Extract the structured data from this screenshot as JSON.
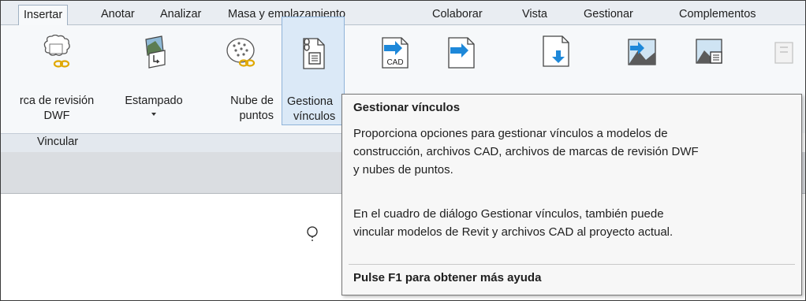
{
  "tabs": [
    {
      "label": "Insertar",
      "active": true
    },
    {
      "label": "Anotar"
    },
    {
      "label": "Analizar"
    },
    {
      "label": "Masa y emplazamiento"
    },
    {
      "label": "Colaborar"
    },
    {
      "label": "Vista"
    },
    {
      "label": "Gestionar"
    },
    {
      "label": "Complementos"
    }
  ],
  "ribbon": {
    "tools": [
      {
        "line1": "rca de revisión",
        "line2": "DWF",
        "icon": "dwf-markup-link-icon"
      },
      {
        "line1": "Estampado",
        "line2": "",
        "icon": "decal-icon",
        "dropdown": true
      },
      {
        "line1": "Nube de",
        "line2": "puntos",
        "icon": "point-cloud-link-icon"
      },
      {
        "line1": "Gestiona",
        "line2": "vínculos",
        "icon": "manage-links-icon",
        "selected": true
      }
    ],
    "panel_label": "Vincular"
  },
  "tooltip": {
    "title": "Gestionar vínculos",
    "para1_lines": [
      "Proporciona opciones para gestionar vínculos a modelos de",
      "construcción, archivos CAD, archivos de marcas de revisión DWF",
      "y nubes de puntos."
    ],
    "para2_lines": [
      "En el cuadro de diálogo Gestionar vínculos, también puede",
      "vincular modelos de Revit y archivos CAD al proyecto actual."
    ],
    "help": "Pulse F1 para obtener más ayuda"
  },
  "icons": {
    "import_cad": "import-cad-icon",
    "link_cad_text": "CAD",
    "accent_blue": "#1e88d9",
    "accent_gold": "#e0a800"
  }
}
